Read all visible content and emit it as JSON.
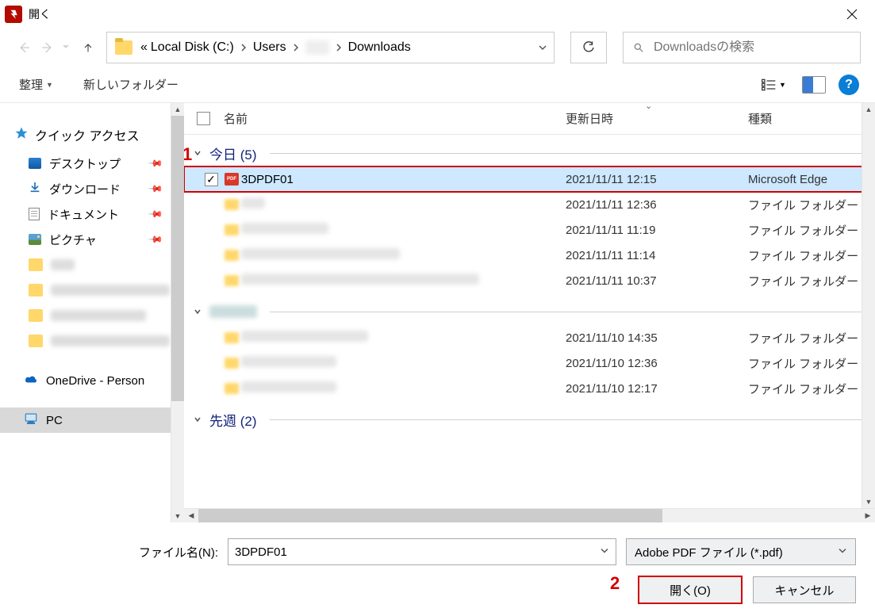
{
  "window": {
    "title": "開く"
  },
  "breadcrumb": {
    "segments": [
      "Local Disk (C:)",
      "Users",
      "",
      "Downloads"
    ],
    "prefix": "«"
  },
  "search": {
    "placeholder": "Downloadsの検索"
  },
  "toolbar": {
    "organize": "整理",
    "new_folder": "新しいフォルダー",
    "help": "?"
  },
  "sidebar": {
    "quick_access": "クイック アクセス",
    "desktop": "デスクトップ",
    "downloads": "ダウンロード",
    "documents": "ドキュメント",
    "pictures": "ピクチャ",
    "onedrive": "OneDrive - Person",
    "pc": "PC"
  },
  "columns": {
    "name": "名前",
    "date": "更新日時",
    "type": "種類"
  },
  "groups": {
    "today": "今日 (5)",
    "lastweek": "先週 (2)"
  },
  "files": {
    "today": [
      {
        "name": "3DPDF01",
        "date": "2021/11/11 12:15",
        "type": "Microsoft Edge",
        "icon": "pdf",
        "selected": true,
        "namew": 0
      },
      {
        "name": "",
        "date": "2021/11/11 12:36",
        "type": "ファイル フォルダー",
        "icon": "folder",
        "namew": 30
      },
      {
        "name": "",
        "date": "2021/11/11 11:19",
        "type": "ファイル フォルダー",
        "icon": "folder",
        "namew": 110
      },
      {
        "name": "",
        "date": "2021/11/11 11:14",
        "type": "ファイル フォルダー",
        "icon": "folder",
        "namew": 200
      },
      {
        "name": "",
        "date": "2021/11/11 10:37",
        "type": "ファイル フォルダー",
        "icon": "folder",
        "namew": 300
      }
    ],
    "mid": [
      {
        "name": "",
        "date": "2021/11/10 14:35",
        "type": "ファイル フォルダー",
        "icon": "folder",
        "namew": 160
      },
      {
        "name": "",
        "date": "2021/11/10 12:36",
        "type": "ファイル フォルダー",
        "icon": "folder",
        "namew": 120
      },
      {
        "name": "",
        "date": "2021/11/10 12:17",
        "type": "ファイル フォルダー",
        "icon": "folder",
        "namew": 120
      }
    ]
  },
  "footer": {
    "filename_label": "ファイル名(N):",
    "filename_value": "3DPDF01",
    "filter": "Adobe PDF ファイル (*.pdf)",
    "open": "開く(O)",
    "cancel": "キャンセル"
  },
  "annotations": {
    "one": "1",
    "two": "2"
  }
}
